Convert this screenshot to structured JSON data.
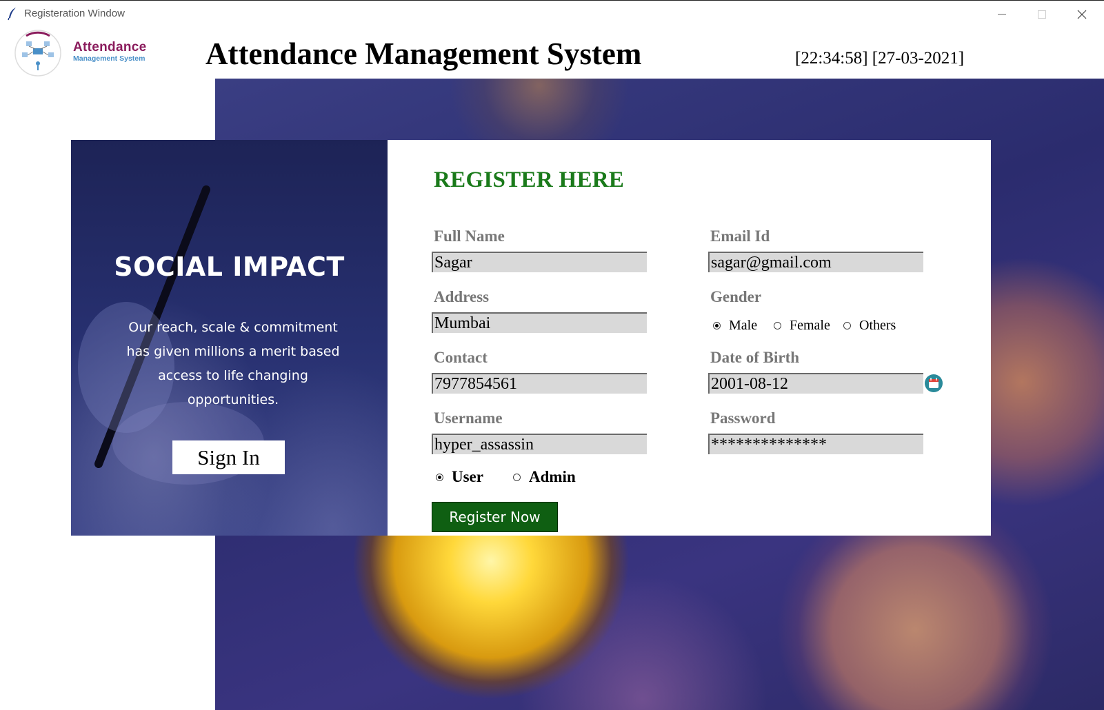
{
  "window": {
    "title": "Registeration Window"
  },
  "header": {
    "logo_line1": "Attendance",
    "logo_line2": "Management System",
    "heading": "Attendance Management System",
    "clock": "[22:34:58] [27-03-2021]"
  },
  "left_panel": {
    "title": "SOCIAL IMPACT",
    "description": "Our reach, scale & commitment has given millions a merit based access to life changing opportunities.",
    "signin_label": "Sign In"
  },
  "form": {
    "title": "REGISTER HERE",
    "full_name": {
      "label": "Full Name",
      "value": "Sagar"
    },
    "email": {
      "label": "Email Id",
      "value": "sagar@gmail.com"
    },
    "address": {
      "label": "Address",
      "value": "Mumbai"
    },
    "gender": {
      "label": "Gender",
      "options": [
        "Male",
        "Female",
        "Others"
      ],
      "selected": "Male"
    },
    "contact": {
      "label": "Contact",
      "value": "7977854561"
    },
    "dob": {
      "label": "Date of Birth",
      "value": "2001-08-12"
    },
    "username": {
      "label": "Username",
      "value": "hyper_assassin"
    },
    "password": {
      "label": "Password",
      "value": "**************"
    },
    "role": {
      "options": [
        "User",
        "Admin"
      ],
      "selected": "User"
    },
    "register_label": "Register Now"
  },
  "colors": {
    "register_title": "#1a7a1a",
    "register_button": "#0f5f12",
    "logo_primary": "#8a1b5c",
    "logo_secondary": "#4a90c8"
  }
}
